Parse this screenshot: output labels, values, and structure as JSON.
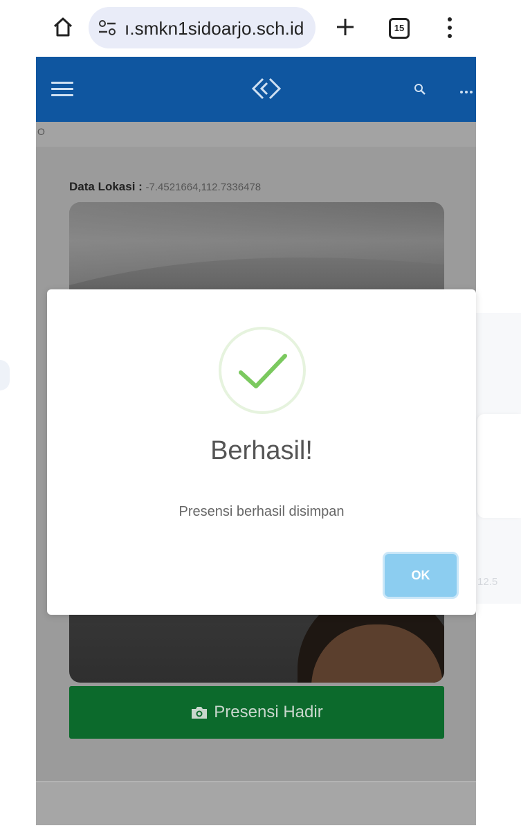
{
  "browser": {
    "url": "ı.smkn1sidoarjo.sch.id",
    "tab_count": "15",
    "icons": [
      "home-icon",
      "site-settings-icon",
      "plus-icon",
      "tabs-icon",
      "kebab-menu-icon"
    ]
  },
  "app": {
    "colors": {
      "app_bar": "#0f56a0",
      "primary_button": "#0c6a2c",
      "ok_button": "#8ccdf0",
      "success_check": "#7bc95f"
    },
    "icons": [
      "hamburger-icon",
      "logo-icon",
      "search-icon",
      "more-icon"
    ],
    "sub_strip_text": "O"
  },
  "location": {
    "label": "Data Lokasi :",
    "value": "-7.4521664,112.7336478"
  },
  "actions": {
    "presensi_label": "Presensi Hadir"
  },
  "dialog": {
    "title": "Berhasil!",
    "message": "Presensi berhasil disimpan",
    "ok_label": "OK"
  },
  "background_fragment": {
    "text": "12.5"
  }
}
